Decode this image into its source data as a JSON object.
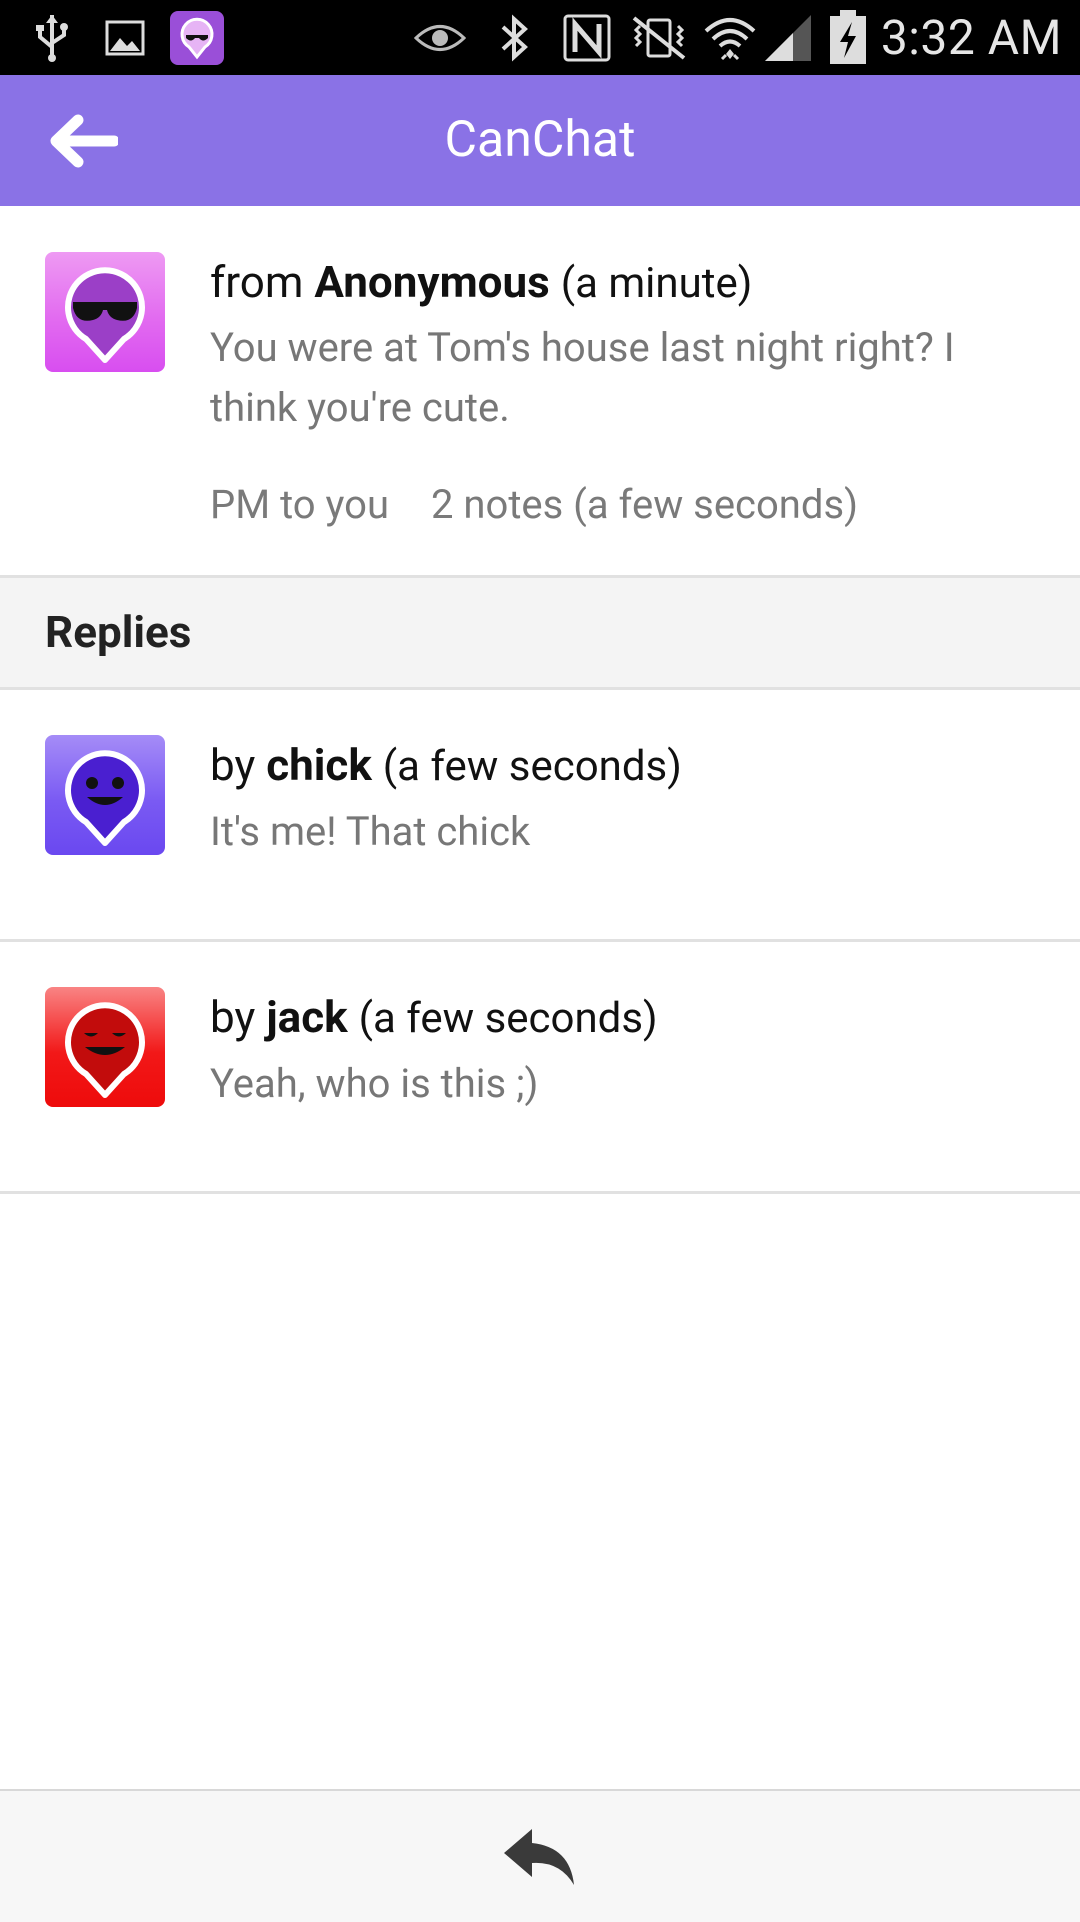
{
  "status_bar": {
    "time": "3:32 AM",
    "icons": [
      "usb-icon",
      "gallery-icon",
      "canchat-notification-icon",
      "eye-icon",
      "bluetooth-icon",
      "nfc-icon",
      "vibrate-icon",
      "wifi-icon",
      "signal-icon",
      "battery-charging-icon"
    ]
  },
  "app_bar": {
    "title": "CanChat",
    "back_icon": "back-arrow-icon"
  },
  "post": {
    "prefix": "from",
    "author": "Anonymous",
    "time": "(a minute)",
    "text": "You were at Tom's house last night right? I think you're cute.",
    "pm_label": "PM to you",
    "notes_label": "2 notes (a few seconds)",
    "avatar_color": "#E26BF0",
    "avatar_icon": "sunglasses-face-pin-icon"
  },
  "replies_section": {
    "title": "Replies"
  },
  "replies": [
    {
      "prefix": "by",
      "author": "chick",
      "time": "(a few seconds)",
      "text": "It's me! That chick",
      "avatar_color": "#7A5AF3",
      "avatar_icon": "smiley-face-pin-icon"
    },
    {
      "prefix": "by",
      "author": "jack",
      "time": "(a few seconds)",
      "text": "Yeah, who is this ;)",
      "avatar_color": "#F21818",
      "avatar_icon": "smirk-face-pin-icon"
    }
  ],
  "bottom_bar": {
    "reply_icon": "reply-icon"
  },
  "colors": {
    "app_bar": "#8A72E6",
    "status_bar": "#000000",
    "section_bg": "#F4F4F4"
  }
}
